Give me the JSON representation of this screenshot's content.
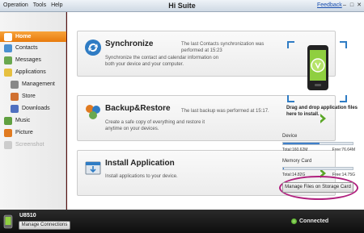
{
  "menu": {
    "operation": "Operation",
    "tools": "Tools",
    "help": "Help"
  },
  "app_title": "Hi Suite",
  "feedback": "Feedback",
  "window_controls": {
    "minimize": "–",
    "maximize": "□",
    "close": "✕"
  },
  "sidebar": {
    "items": [
      {
        "label": "Home",
        "icon": "home-icon",
        "color": "#f0a030"
      },
      {
        "label": "Contacts",
        "icon": "contacts-icon",
        "color": "#4a90d0"
      },
      {
        "label": "Messages",
        "icon": "messages-icon",
        "color": "#6aa84f"
      },
      {
        "label": "Applications",
        "icon": "applications-icon",
        "color": "#e6c040"
      },
      {
        "label": "Management",
        "icon": "management-icon",
        "color": "#888888"
      },
      {
        "label": "Store",
        "icon": "store-icon",
        "color": "#d07030"
      },
      {
        "label": "Downloads",
        "icon": "downloads-icon",
        "color": "#5070c0"
      },
      {
        "label": "Music",
        "icon": "music-icon",
        "color": "#60a040"
      },
      {
        "label": "Picture",
        "icon": "picture-icon",
        "color": "#e07a20"
      },
      {
        "label": "Screenshot",
        "icon": "screenshot-icon",
        "color": "#cccccc"
      }
    ]
  },
  "cards": {
    "sync": {
      "title": "Synchronize",
      "status": "The last Contacts  synchronization was performed at 15:23",
      "desc": "Synchronize the contact and calendar information on both your device and your computer."
    },
    "backup": {
      "title": "Backup&Restore",
      "status": "The last backup was performed at 15:17.",
      "desc": "Create a safe copy of everything and restore it anytime on your devices."
    },
    "install": {
      "title": "Install Application",
      "desc": "Install applications to your device."
    }
  },
  "right_panel": {
    "drop_text": "Drag and drop application files here to install.",
    "device_label": "Device",
    "device_total": "Total:160.62M",
    "device_free": "Free:76.64M",
    "device_used_fraction": 0.52,
    "card_label": "Memory Card",
    "card_total": "Total:14.82G",
    "card_free": "Free:14.75G",
    "card_used_fraction": 0.01,
    "manage_button": "Manage Files on Storage Card"
  },
  "bottom": {
    "model": "U8510",
    "manage_connections": "Manage Connections",
    "status": "Connected"
  },
  "colors": {
    "accent": "#f08a1e",
    "arrow_green": "#5aa626",
    "highlight_circle": "#b0207e"
  }
}
